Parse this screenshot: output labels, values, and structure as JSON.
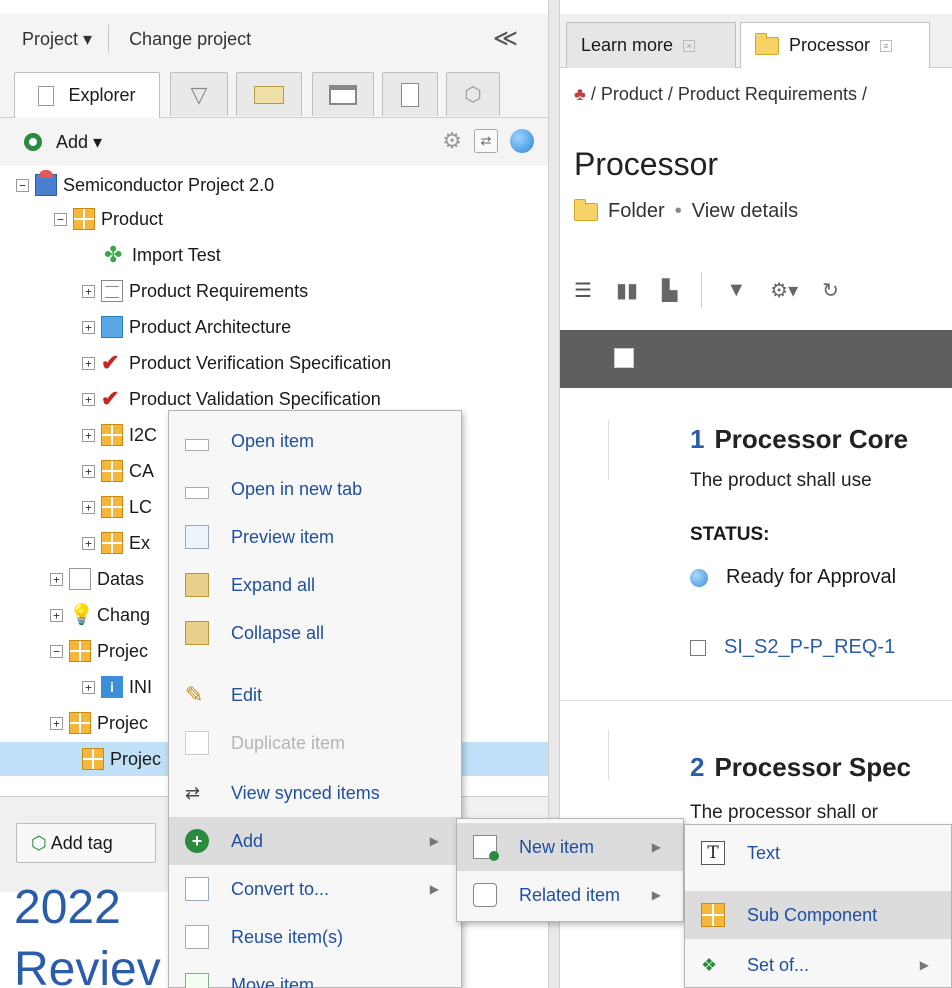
{
  "left": {
    "project_menu": "Project ▾",
    "change_project": "Change project",
    "collapse_glyph": "≪",
    "explorer_tab": "Explorer",
    "add_label": "Add ▾",
    "tree": {
      "root": "Semiconductor Project 2.0",
      "product": "Product",
      "import_test": "Import Test",
      "product_requirements": "Product Requirements",
      "product_architecture": "Product Architecture",
      "product_verification": "Product Verification Specification",
      "product_validation": "Product Validation Specification",
      "i2c": "I2C",
      "ca": "CA",
      "lc": "LC",
      "ex": "Ex",
      "datas": "Datas",
      "chang": "Chang",
      "projec_1": "Projec",
      "ini": "INI",
      "projec_2": "Projec",
      "projec_3": "Projec"
    },
    "add_tag": "Add tag",
    "big_year": "2022",
    "big_review": "Reviev"
  },
  "right": {
    "tab_learn_more": "Learn more",
    "tab_processor": "Processor",
    "breadcrumb": "/ Product / Product Requirements /",
    "title": "Processor",
    "meta_folder": "Folder",
    "meta_view_details": "View details",
    "section1_num": "1",
    "section1_title": "Processor Core",
    "section1_text": "The product shall use",
    "status_label": "STATUS:",
    "status_value": "Ready for Approval",
    "link_id": "SI_S2_P-P_REQ-1",
    "section2_num": "2",
    "section2_title": "Processor Spec",
    "section2_text": "The processor shall or"
  },
  "context_menu": {
    "items": [
      {
        "label": "Open item"
      },
      {
        "label": "Open in new tab"
      },
      {
        "label": "Preview item"
      },
      {
        "label": "Expand all"
      },
      {
        "label": "Collapse all"
      },
      {
        "label": "Edit"
      },
      {
        "label": "Duplicate item"
      },
      {
        "label": "View synced items"
      },
      {
        "label": "Add"
      },
      {
        "label": "Convert to..."
      },
      {
        "label": "Reuse item(s)"
      },
      {
        "label": "Move item"
      }
    ]
  },
  "submenu_add": {
    "items": [
      {
        "label": "New item"
      },
      {
        "label": "Related item"
      }
    ]
  },
  "submenu_new": {
    "items": [
      {
        "label": "Text"
      },
      {
        "label": "Sub Component"
      },
      {
        "label": "Set of..."
      }
    ]
  },
  "colors": {
    "link_blue": "#1f4fa0",
    "selected_row": "#bfe0f7",
    "dark_bar": "#5f5f5f",
    "component_orange": "#f5b73b"
  }
}
